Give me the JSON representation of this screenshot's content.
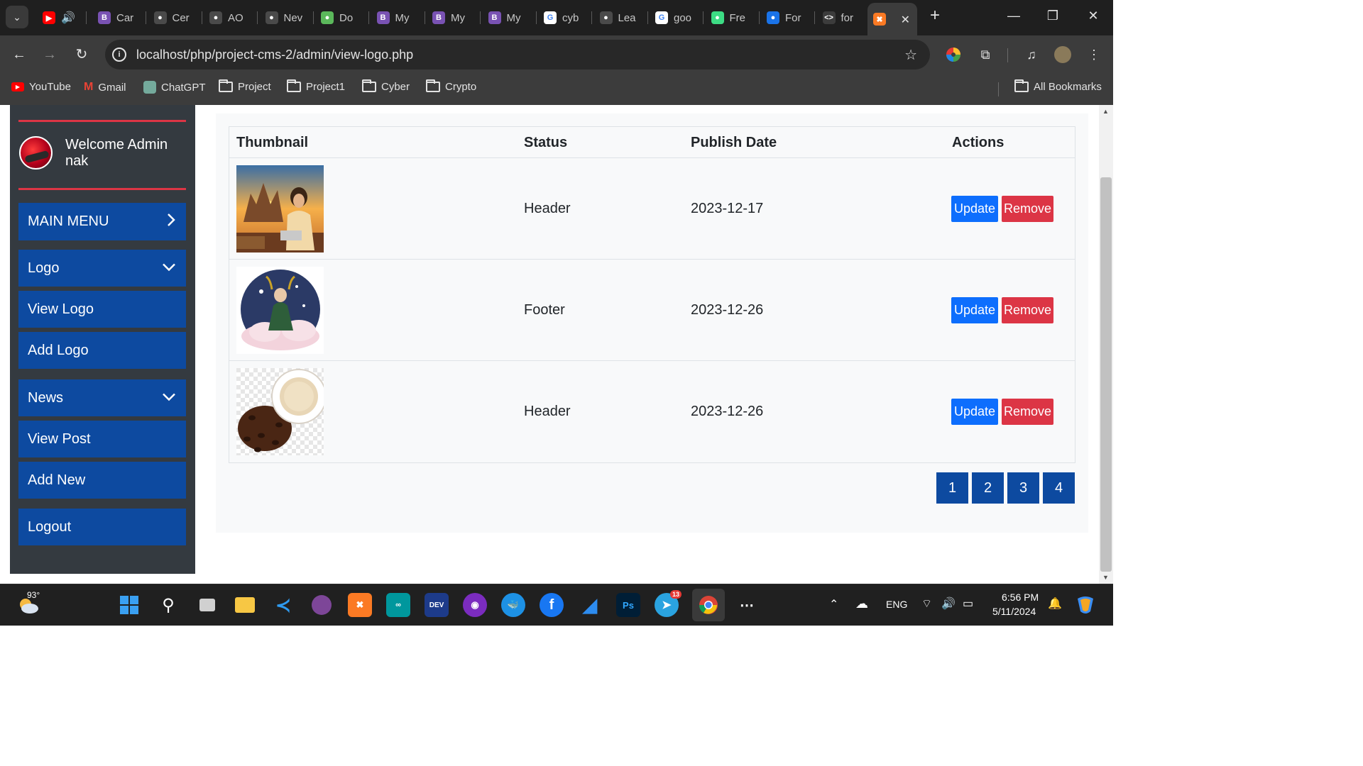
{
  "browser": {
    "tabs": [
      {
        "label": "Car",
        "icon": "bootstrap-icon",
        "color": "#7952b3"
      },
      {
        "label": "Cer",
        "icon": "chatgpt-icon",
        "color": "#4a4a4a"
      },
      {
        "label": "AO",
        "icon": "globe-icon",
        "color": "#4a4a4a"
      },
      {
        "label": "Nev",
        "icon": "chatgpt-icon",
        "color": "#4a4a4a"
      },
      {
        "label": "Do",
        "icon": "leaf-icon",
        "color": "#5bb85b"
      },
      {
        "label": "My",
        "icon": "bootstrap-icon",
        "color": "#7952b3"
      },
      {
        "label": "My",
        "icon": "bootstrap-icon",
        "color": "#7952b3"
      },
      {
        "label": "My",
        "icon": "bootstrap-icon",
        "color": "#7952b3"
      },
      {
        "label": "cyb",
        "icon": "google-icon",
        "color": "#ffffff"
      },
      {
        "label": "Lea",
        "icon": "globe-icon",
        "color": "#4a4a4a"
      },
      {
        "label": "goo",
        "icon": "google-icon",
        "color": "#ffffff"
      },
      {
        "label": "Fre",
        "icon": "android-icon",
        "color": "#3ddc84"
      },
      {
        "label": "For",
        "icon": "flag-icon",
        "color": "#1a73e8"
      },
      {
        "label": "for",
        "icon": "code-icon",
        "color": "#3c3c3c"
      }
    ],
    "url": "localhost/php/project-cms-2/admin/view-logo.php",
    "bookmarks": [
      {
        "label": "YouTube",
        "icon": "youtube-icon"
      },
      {
        "label": "Gmail",
        "icon": "gmail-icon"
      },
      {
        "label": "ChatGPT",
        "icon": "chatgpt-icon"
      },
      {
        "label": "Project",
        "icon": "folder-icon"
      },
      {
        "label": "Project1",
        "icon": "folder-icon"
      },
      {
        "label": "Cyber",
        "icon": "folder-icon"
      },
      {
        "label": "Crypto",
        "icon": "folder-icon"
      }
    ],
    "all_bookmarks": "All Bookmarks"
  },
  "sidebar": {
    "welcome": "Welcome Admin nak",
    "main_menu": "MAIN MENU",
    "logo_group": "Logo",
    "view_logo": "View Logo",
    "add_logo": "Add Logo",
    "news_group": "News",
    "view_post": "View Post",
    "add_new": "Add New",
    "logout": "Logout"
  },
  "table": {
    "headers": {
      "thumbnail": "Thumbnail",
      "status": "Status",
      "publish_date": "Publish Date",
      "actions": "Actions"
    },
    "rows": [
      {
        "status": "Header",
        "date": "2023-12-17",
        "thumb": "temple-woman-laptop"
      },
      {
        "status": "Footer",
        "date": "2023-12-26",
        "thumb": "loki-on-cloud"
      },
      {
        "status": "Header",
        "date": "2023-12-26",
        "thumb": "coffee-beans-cup"
      }
    ],
    "update_label": "Update",
    "remove_label": "Remove"
  },
  "pagination": [
    "1",
    "2",
    "3",
    "4"
  ],
  "taskbar": {
    "temperature": "93°",
    "language": "ENG",
    "time": "6:56 PM",
    "date": "5/11/2024",
    "telegram_badge": "13"
  },
  "colors": {
    "sidebar_bg": "#343a40",
    "menu_blue": "#0d4aa0",
    "accent_red": "#dc3545",
    "update_blue": "#0d6efd"
  }
}
